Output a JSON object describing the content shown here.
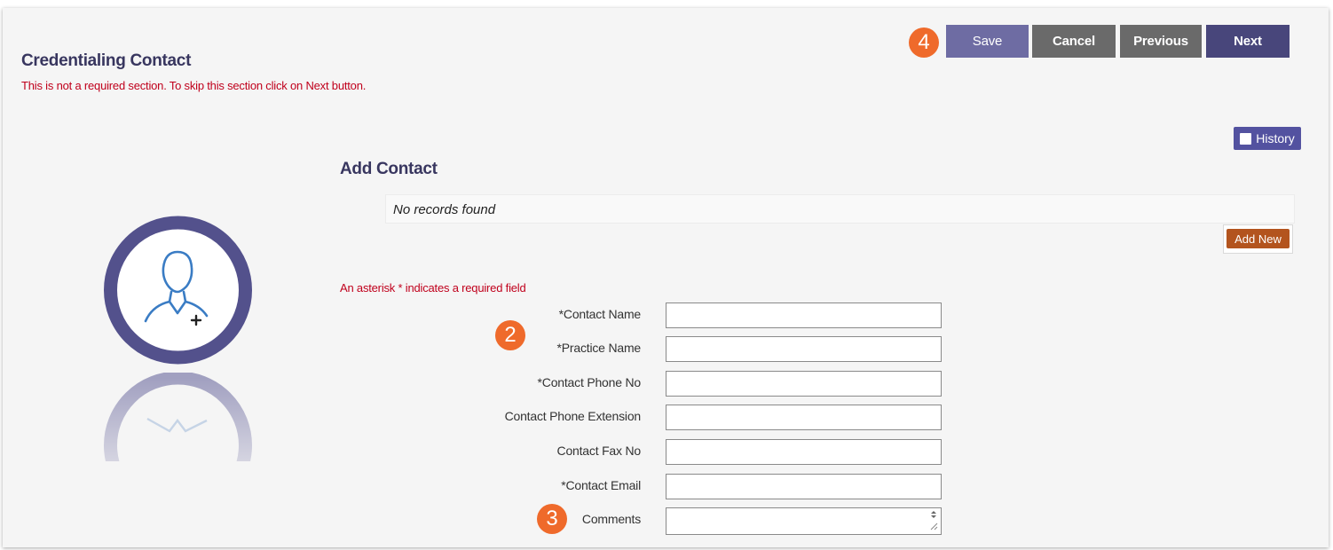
{
  "section": {
    "title": "Credentialing Contact",
    "skip_note": "This is not a required section. To skip this section click on Next button."
  },
  "toolbar": {
    "save_label": "Save",
    "cancel_label": "Cancel",
    "previous_label": "Previous",
    "next_label": "Next"
  },
  "steps": [
    "4",
    "2",
    "3"
  ],
  "history": {
    "label": "History",
    "icon": "book-icon"
  },
  "add_contact": {
    "title": "Add Contact",
    "empty_text": "No records found",
    "add_new_label": "Add New"
  },
  "form": {
    "required_note": "An asterisk * indicates a required field",
    "fields": [
      {
        "label": "*Contact Name",
        "value": ""
      },
      {
        "label": "*Practice Name",
        "value": ""
      },
      {
        "label": "*Contact Phone No",
        "value": ""
      },
      {
        "label": "Contact Phone Extension",
        "value": ""
      },
      {
        "label": "Contact Fax No",
        "value": ""
      },
      {
        "label": "*Contact Email",
        "value": ""
      },
      {
        "label": "Comments",
        "value": ""
      }
    ]
  },
  "colors": {
    "accent": "#48467b",
    "save": "#6e6ca3",
    "neutral_button": "#6a6a6a",
    "warning_text": "#c0001c",
    "step_badge": "#ef6a2b",
    "add_new": "#b3541e"
  }
}
